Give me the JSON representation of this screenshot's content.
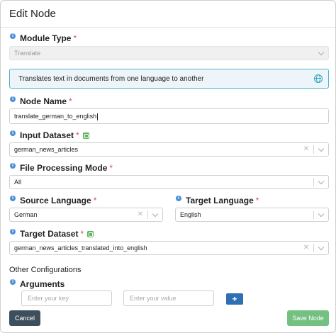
{
  "modal": {
    "title": "Edit Node"
  },
  "module_type": {
    "label": "Module Type",
    "value": "Translate"
  },
  "description": {
    "text": "Translates text in documents from one language to another"
  },
  "node_name": {
    "label": "Node Name",
    "value": "translate_german_to_english"
  },
  "input_dataset": {
    "label": "Input Dataset",
    "value": "german_news_articles"
  },
  "file_processing_mode": {
    "label": "File Processing Mode",
    "value": "All"
  },
  "source_language": {
    "label": "Source Language",
    "value": "German"
  },
  "target_language": {
    "label": "Target Language",
    "value": "English"
  },
  "target_dataset": {
    "label": "Target Dataset",
    "value": "german_news_articles_translated_into_english"
  },
  "other_configurations": {
    "title": "Other Configurations"
  },
  "arguments": {
    "label": "Arguments",
    "key_placeholder": "Enter your key",
    "value_placeholder": "Enter your value",
    "add_label": "+"
  },
  "footer": {
    "cancel_label": "Cancel",
    "save_label": "Save Node"
  },
  "required_marker": "*",
  "info_marker": "i",
  "clear_marker": "✕",
  "icons": {
    "info": "info-icon",
    "copy": "copy-icon",
    "globe": "globe-icon",
    "clear": "clear-icon",
    "chevron": "chevron-down-icon"
  },
  "colors": {
    "info": "#4a90d9",
    "required": "#d9534f",
    "description_border": "#4bb3c9",
    "description_bg": "#eef5fa",
    "add_button": "#2f6fb3",
    "cancel_button": "#3d4f5c",
    "save_button": "#73c081",
    "copy_icon": "#5cb85c"
  }
}
